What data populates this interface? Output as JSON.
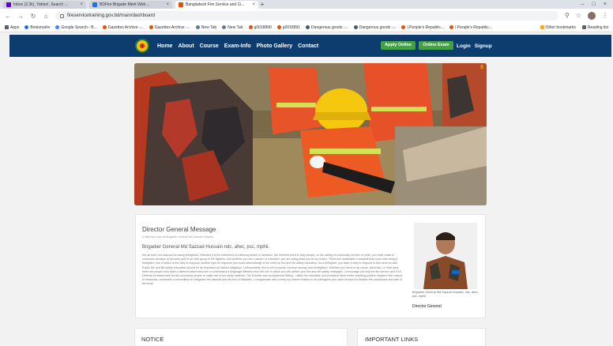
{
  "browser": {
    "tabs": [
      {
        "title": "Inbox (2.2k), Yahoo!, Search ·..",
        "active": false,
        "color": "#6001d2"
      },
      {
        "title": "BDFire Brigade Merit Web ...",
        "active": false,
        "color": "#1a73e8"
      },
      {
        "title": "Bangladesh Fire Service and Ci...",
        "active": true,
        "color": "#e65100"
      }
    ],
    "url": "fireservicetraining.gov.bd/main/dashboard",
    "bookmarks": [
      "Apps",
      "Bookmarks",
      "Google Search - B...",
      "Gazettes Archive -...",
      "Gazettes Archive -...",
      "New Tab",
      "New Tab",
      "g0018890",
      "g0018891",
      "Dangerous goods -...",
      "Dangerous goods -...",
      "| People's Republic...",
      "| People's Republic..."
    ],
    "bookmarks_right": [
      "Other bookmarks",
      "Reading list"
    ]
  },
  "site": {
    "nav": [
      "Home",
      "About",
      "Course",
      "Exam-Info",
      "Photo Gallery",
      "Contact"
    ],
    "apply_label": "Apply Online",
    "exam_label": "Online Exam",
    "login_label": "Login",
    "signup_label": "Signup",
    "hero_badge": "8"
  },
  "director": {
    "heading": "Director General Message",
    "meta": "A little finer topic at Brigadier General Md Sazzad Hossain",
    "name": "Brigadier General Md Sazzad Hussain ndc, afwc, psc, mphil.",
    "body": "We all have our reasons for being firefighters. Whether it is the fulfillment of a lifelong dream or ambition, the inherent need to help people, or the calling of community service or pride, you have made a conscious decision to become part of an elite group of fire fighters. And whether you are a career or volunteer, you are doing what you do by choice. There are undeniable constants that come with being a firefighter, one of which is the duty to respond; another type of response you must acknowledge is the need for fire and life safety education. As a firefighter, you have a duty to respond to this need as well. Public fire and life safety education should be as important as hazard mitigation. Unfortunately, this is not a popular concept among most firefighters. Whether you serve in an urban, suburban, or rural area, there are people who have a different belief structure or understand a language different from the one in which you will deliver your fire and life safety messages. I encourage not only the fire service and Civil Defense professionals but all concerned people to make use of the study material. The Science and occupational Safety... utilize the education and proactive effort which resulting positive impact in the rescue of industries, vulnerable communities for mitigation the hazards and all kind of disasters. I congratulate and convey my sincere thanks to all colleagues who were involved to finalize the procedures and web of the book.",
    "caption": "Brigadier General Md Sazzad Hussain, ndc, afwc, psc, mphil",
    "role": "Director General"
  },
  "notice": {
    "title": "NOTICE"
  },
  "links": {
    "title": "IMPORTANT LINKS"
  }
}
